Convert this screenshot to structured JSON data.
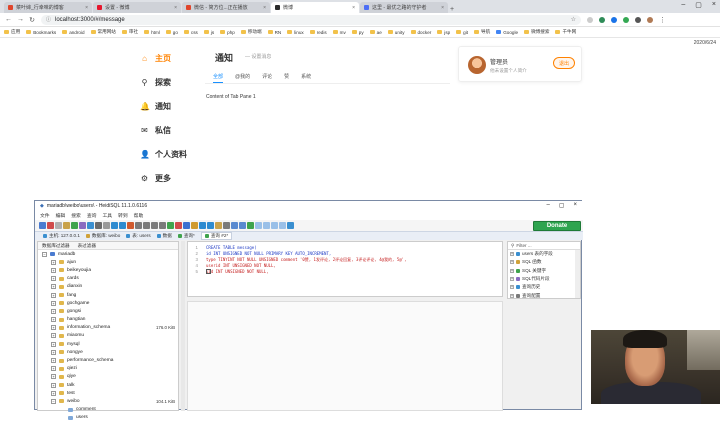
{
  "browser": {
    "tabs": [
      {
        "label": "菜叶婶_行幸味的博客",
        "color": "#e0452b",
        "active": false
      },
      {
        "label": "设置 - 微博",
        "color": "#e6162d",
        "active": false
      },
      {
        "label": "微信 - 简方位...正在播放",
        "color": "#e0452b",
        "active": false
      },
      {
        "label": "微博",
        "color": "#2b2b2b",
        "active": true
      },
      {
        "label": "这里 - 最优之路的守护者",
        "color": "#4c6ef5",
        "active": false
      }
    ],
    "url": "localhost:3000/#/message",
    "bookmarks": [
      "应用",
      "Bookmarks",
      "android",
      "常用网站",
      "审社",
      "html",
      "go",
      "css",
      "js",
      "php",
      "移动端",
      "RN",
      "linux",
      "redis",
      "mv",
      "py",
      "ae",
      "unity",
      "docker",
      "jsp",
      "git",
      "导航",
      "Google",
      "微博搜索",
      "千牛网"
    ]
  },
  "nav": [
    {
      "label": "主页",
      "icon": "⌂",
      "active": true
    },
    {
      "label": "探索",
      "icon": "⚲",
      "active": false
    },
    {
      "label": "通知",
      "icon": "🔔",
      "active": false
    },
    {
      "label": "私信",
      "icon": "✉",
      "active": false
    },
    {
      "label": "个人资料",
      "icon": "👤",
      "active": false
    },
    {
      "label": "更多",
      "icon": "⚙",
      "active": false
    }
  ],
  "notice": {
    "title": "通知",
    "subtitle": "— 设置消息",
    "tabs": [
      {
        "label": "全部",
        "active": true
      },
      {
        "label": "@我的",
        "active": false
      },
      {
        "label": "评论",
        "active": false
      },
      {
        "label": "赞",
        "active": false
      },
      {
        "label": "系统",
        "active": false
      }
    ],
    "pane_text": "Content of Tab Pane 1"
  },
  "user": {
    "name": "管理员",
    "bio": "他未设置个人简介",
    "logout": "退出"
  },
  "corner_date": "2020/6/24",
  "heidi": {
    "title": "mariadb\\weibo\\users\\ - HeidiSQL 11.1.0.6116",
    "menu": [
      "文件",
      "编辑",
      "搜索",
      "查询",
      "工具",
      "转到",
      "帮助"
    ],
    "donate": "Donate",
    "tree_filter": [
      "数据库过滤器",
      "表过滤器"
    ],
    "tabs": [
      "主机: 127.0.0.1",
      "数据库: weibo",
      "表: users",
      "数据",
      "查询*",
      "查询 #2*"
    ],
    "tree": [
      {
        "name": "mariadb",
        "level": 0,
        "size": ""
      },
      {
        "name": "ajun",
        "level": 1,
        "size": ""
      },
      {
        "name": "beikeyoujia",
        "level": 1,
        "size": ""
      },
      {
        "name": "cards",
        "level": 1,
        "size": ""
      },
      {
        "name": "dianxin",
        "level": 1,
        "size": ""
      },
      {
        "name": "fang",
        "level": 1,
        "size": ""
      },
      {
        "name": "gochgame",
        "level": 1,
        "size": ""
      },
      {
        "name": "gongsi",
        "level": 1,
        "size": ""
      },
      {
        "name": "hangtian",
        "level": 1,
        "size": ""
      },
      {
        "name": "information_schema",
        "level": 1,
        "size": "176.0 KiB"
      },
      {
        "name": "miaomu",
        "level": 1,
        "size": ""
      },
      {
        "name": "mysql",
        "level": 1,
        "size": ""
      },
      {
        "name": "nongye",
        "level": 1,
        "size": ""
      },
      {
        "name": "performance_schema",
        "level": 1,
        "size": ""
      },
      {
        "name": "qiezi",
        "level": 1,
        "size": ""
      },
      {
        "name": "qiye",
        "level": 1,
        "size": ""
      },
      {
        "name": "talk",
        "level": 1,
        "size": ""
      },
      {
        "name": "test",
        "level": 1,
        "size": ""
      },
      {
        "name": "weibo",
        "level": 1,
        "size": "104.1 KiB"
      },
      {
        "name": "comment",
        "level": 2,
        "size": ""
      },
      {
        "name": "users",
        "level": 2,
        "size": ""
      }
    ],
    "sql": [
      "CREATE TABLE message(",
      "id INT UNSIGNED NOT NULL PRIMARY KEY  AUTO_INCREMENT,",
      "type TINYINT NOT NULL UNSIGNED comment '0赞, 1发评论, 2评论回复, 3评论评论, 4@我的, 5@',",
      "userid INT UNSIGNED NOT NULL,",
      "uid INT UNSIGNED NOT NULL,"
    ],
    "helpers_filter": "Filter ...",
    "helpers": [
      "users 表的字段",
      "SQL 函数",
      "SQL 关键字",
      "SQL代码片段",
      "查询历史",
      "查询配置"
    ]
  }
}
